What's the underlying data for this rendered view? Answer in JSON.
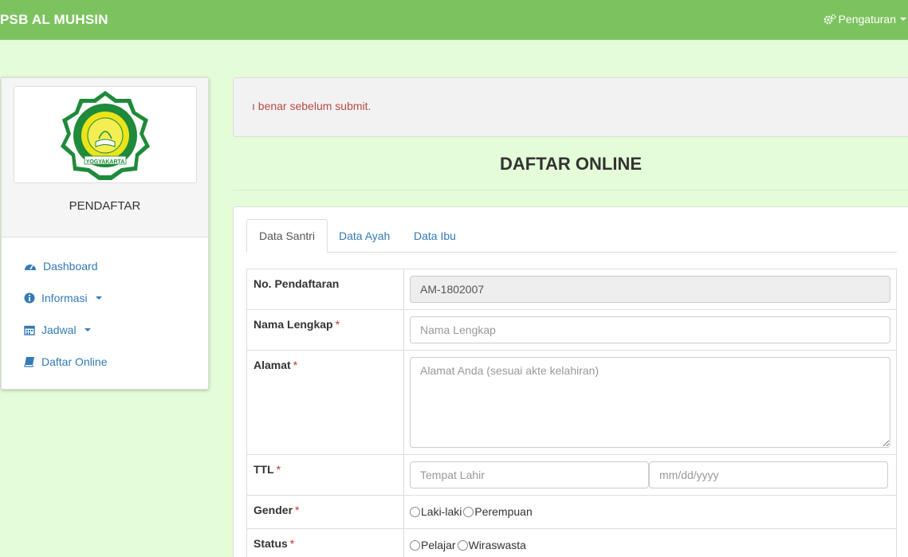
{
  "navbar": {
    "brand": "PSB AL MUHSIN",
    "settings_label": "Pengaturan",
    "settings_icon": "gears-icon"
  },
  "sidebar": {
    "logo_ring_text": "YOGYAKARTA",
    "title": "PENDAFTAR",
    "items": [
      {
        "label": "Dashboard",
        "icon": "dashboard-icon"
      },
      {
        "label": "Informasi",
        "icon": "info-circle-icon",
        "dropdown": true
      },
      {
        "label": "Jadwal",
        "icon": "calendar-icon",
        "dropdown": true
      },
      {
        "label": "Daftar Online",
        "icon": "book-icon"
      }
    ]
  },
  "alert": {
    "text": "ı benar sebelum submit."
  },
  "page_title": "DAFTAR ONLINE",
  "tabs": [
    {
      "label": "Data Santri",
      "active": true
    },
    {
      "label": "Data Ayah",
      "active": false
    },
    {
      "label": "Data Ibu",
      "active": false
    }
  ],
  "form": {
    "no_pendaftaran": {
      "label": "No. Pendaftaran",
      "value": "AM-1802007"
    },
    "nama": {
      "label": "Nama Lengkap",
      "required": "*",
      "placeholder": "Nama Lengkap"
    },
    "alamat": {
      "label": "Alamat",
      "required": "*",
      "placeholder": "Alamat Anda (sesuai akte kelahiran)"
    },
    "ttl": {
      "label": "TTL",
      "required": "*",
      "tempat_placeholder": "Tempat Lahir",
      "tanggal_placeholder": "mm/dd/yyyy"
    },
    "gender": {
      "label": "Gender",
      "required": "*",
      "options": [
        "Laki-laki",
        "Perempuan"
      ]
    },
    "status": {
      "label": "Status",
      "required": "*",
      "options": [
        "Pelajar",
        "Wiraswasta"
      ]
    }
  },
  "colors": {
    "navbar": "#7cc35f",
    "background": "#e4fdd8",
    "link": "#337ab7",
    "alert_text": "#b94a48"
  }
}
